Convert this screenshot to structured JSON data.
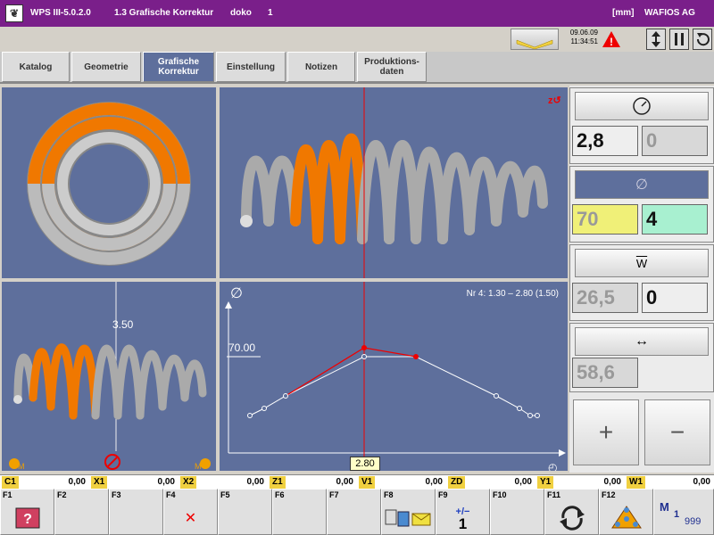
{
  "title": {
    "app": "WPS III-5.0.2.0",
    "view": "1.3 Grafische Korrektur",
    "user": "doko",
    "num": "1",
    "unit": "[mm]",
    "company": "WAFIOS AG"
  },
  "status": {
    "date": "09.06.09",
    "time": "11:34:51"
  },
  "tabs": [
    {
      "label": "Katalog"
    },
    {
      "label": "Geometrie"
    },
    {
      "label": "Grafische Korrektur"
    },
    {
      "label": "Einstellung"
    },
    {
      "label": "Notizen"
    },
    {
      "label": "Produktions- daten"
    }
  ],
  "graph": {
    "info": "Nr 4: 1.30 – 2.80 (1.50)",
    "ylabel_value": "70.00",
    "x_marker": "2.80",
    "pane2_marker": "3.50"
  },
  "right_panel": {
    "pitch": {
      "a": "2,8",
      "b": "0"
    },
    "diameter": {
      "a": "70",
      "b": "4"
    },
    "wire": {
      "symbol": "W",
      "a": "26,5",
      "b": "0"
    },
    "length": {
      "a": "58,6"
    },
    "plus": "+",
    "minus": "−"
  },
  "axes": [
    {
      "label": "C1",
      "value": "0,00"
    },
    {
      "label": "X1",
      "value": "0,00"
    },
    {
      "label": "X2",
      "value": "0,00"
    },
    {
      "label": "Z1",
      "value": "0,00"
    },
    {
      "label": "V1",
      "value": "0,00"
    },
    {
      "label": "ZD",
      "value": "0,00"
    },
    {
      "label": "Y1",
      "value": "0,00"
    },
    {
      "label": "W1",
      "value": "0,00"
    }
  ],
  "fkeys": [
    {
      "label": "F1"
    },
    {
      "label": "F2"
    },
    {
      "label": "F3"
    },
    {
      "label": "F4"
    },
    {
      "label": "F5"
    },
    {
      "label": "F6"
    },
    {
      "label": "F7"
    },
    {
      "label": "F8"
    },
    {
      "label": "F9",
      "text": "1",
      "sign": "+/−"
    },
    {
      "label": "F10"
    },
    {
      "label": "F11"
    },
    {
      "label": "F12"
    }
  ],
  "mcount": {
    "m": "M",
    "a": "1",
    "b": "999"
  },
  "colors": {
    "title": "#7a1f8a",
    "pane": "#5e6f9c",
    "orange": "#f07800"
  }
}
